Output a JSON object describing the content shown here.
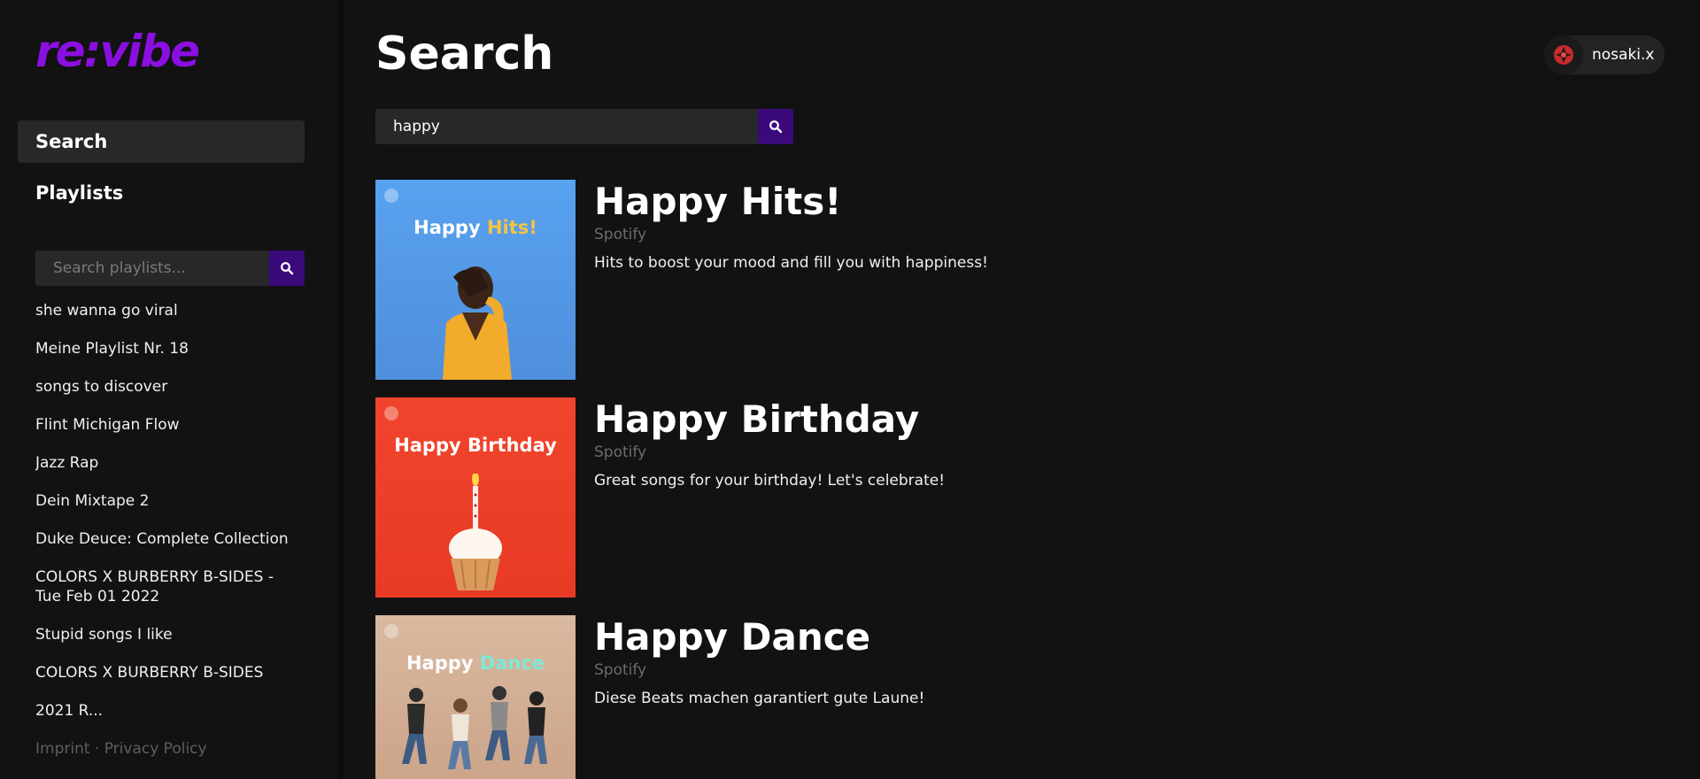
{
  "app": {
    "logo": "re:vibe",
    "accent": "#8a0fe0",
    "button_color": "#3a0a7a"
  },
  "sidebar": {
    "nav": [
      {
        "label": "Search",
        "active": true
      },
      {
        "label": "Playlists",
        "active": false
      }
    ],
    "search": {
      "placeholder": "Search playlists...",
      "icon": "search-icon"
    },
    "playlists": [
      "she wanna go viral",
      "Meine Playlist Nr. 18",
      "songs to discover",
      "Flint Michigan Flow",
      "Jazz Rap",
      "Dein Mixtape 2",
      "Duke Deuce: Complete Collection",
      "COLORS X BURBERRY B-SIDES - Tue Feb 01 2022",
      "Stupid songs I like",
      "COLORS X BURBERRY B-SIDES",
      "2021 R..."
    ],
    "footer": "Imprint · Privacy Policy"
  },
  "header": {
    "title": "Search",
    "user": {
      "name": "nosaki.x",
      "avatar_icon": "avatar-icon"
    }
  },
  "main": {
    "search": {
      "value": "happy",
      "icon": "search-icon"
    },
    "results": [
      {
        "title": "Happy Hits!",
        "owner": "Spotify",
        "description": "Hits to boost your mood and fill you with happiness!",
        "cover_text_a": "Happy ",
        "cover_text_b": "Hits!",
        "cover_accent": "#f6c343"
      },
      {
        "title": "Happy Birthday",
        "owner": "Spotify",
        "description": "Great songs for your birthday! Let's celebrate!",
        "cover_text_a": "Happy Birthday",
        "cover_text_b": "",
        "cover_accent": "#ffffff"
      },
      {
        "title": "Happy Dance",
        "owner": "Spotify",
        "description": "Diese Beats machen garantiert gute Laune!",
        "cover_text_a": "Happy ",
        "cover_text_b": "Dance",
        "cover_accent": "#7fe8d6"
      }
    ]
  }
}
